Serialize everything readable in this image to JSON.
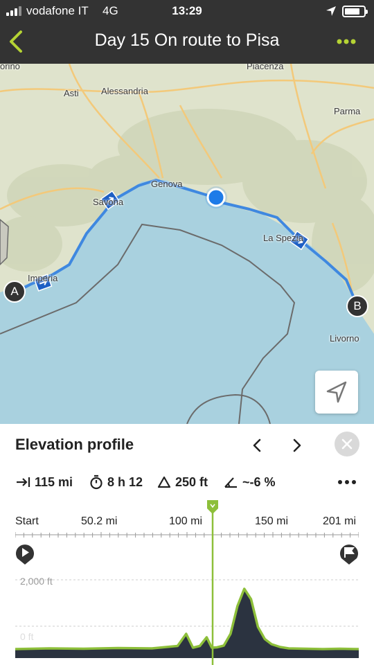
{
  "status_bar": {
    "carrier": "vodafone IT",
    "network": "4G",
    "time": "13:29",
    "battery_level": 0.8
  },
  "header": {
    "title": "Day 15 On route to Pisa",
    "back_icon": "chevron-left-icon",
    "menu_icon": "more-dots-icon",
    "accent_color": "#b5d334"
  },
  "map": {
    "cities": {
      "piacenza": "Piacenza",
      "asti": "Asti",
      "alessandria": "Alessandria",
      "parma": "Parma",
      "genova": "Genova",
      "savona": "Savona",
      "la_spezia": "La Spezia",
      "imperia": "Imperia",
      "livorno": "Livorno",
      "torino_partial": "orino"
    },
    "markers": {
      "start": "A",
      "end": "B"
    },
    "route_color": "#3f88e0",
    "current_location_color": "#1e7be8"
  },
  "elevation": {
    "title": "Elevation profile",
    "stats": {
      "distance": "115 mi",
      "duration": "8 h 12",
      "ascent": "250 ft",
      "grade": "~-6 %"
    },
    "scale_labels": [
      "Start",
      "50.2 mi",
      "100 mi",
      "150 mi",
      "201 mi"
    ],
    "axis_labels": {
      "high": "2,000 ft",
      "low": "0 ft"
    },
    "cursor_position_fraction": 0.575,
    "chart_data": {
      "type": "area",
      "x_unit": "mi",
      "y_unit": "ft",
      "x": [
        0,
        20,
        40,
        60,
        80,
        95,
        100,
        104,
        108,
        112,
        115,
        118,
        122,
        126,
        130,
        134,
        138,
        142,
        146,
        150,
        155,
        160,
        170,
        180,
        190,
        201
      ],
      "y": [
        60,
        80,
        70,
        90,
        80,
        150,
        500,
        100,
        150,
        400,
        100,
        110,
        160,
        500,
        1300,
        1800,
        1500,
        700,
        350,
        200,
        120,
        80,
        70,
        60,
        70,
        60
      ],
      "ylim": [
        0,
        2200
      ],
      "xlim": [
        0,
        201
      ],
      "fill_color": "#2b3340",
      "line_color": "#8dbf3a"
    }
  }
}
